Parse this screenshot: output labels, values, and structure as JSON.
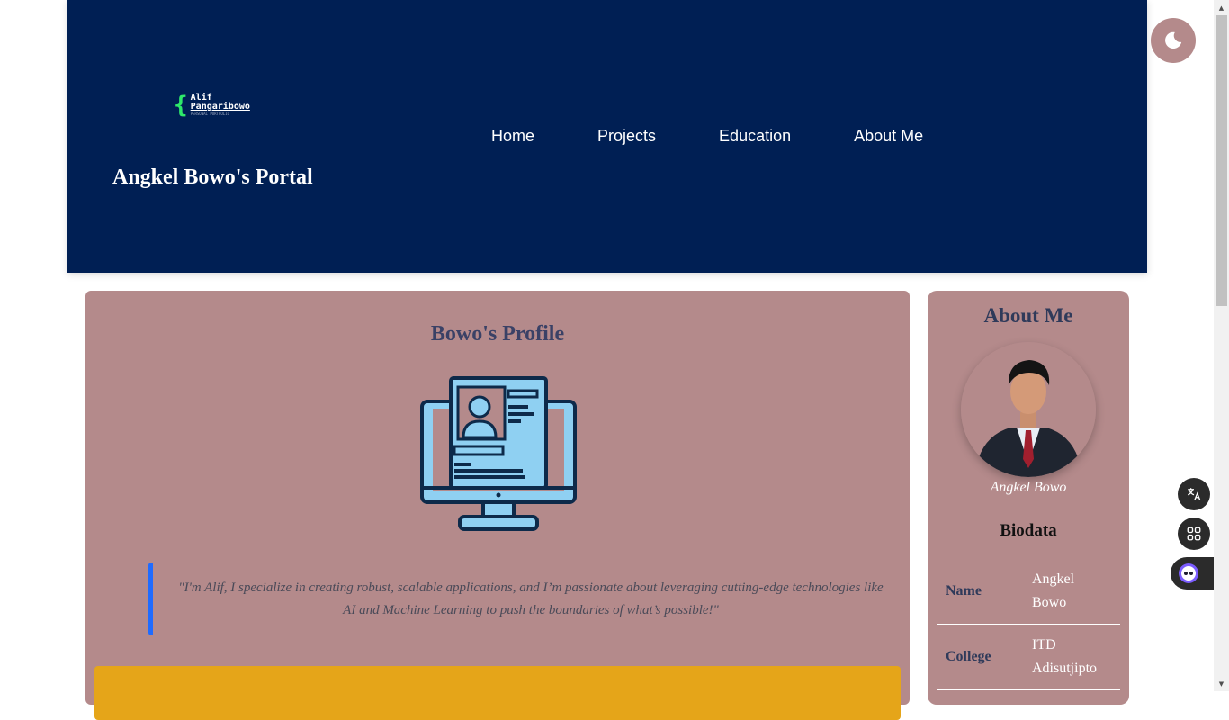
{
  "header": {
    "logo": {
      "line1": "Alif",
      "line2": "Pangaribowo",
      "tagline": "PERSONAL PORTFOLIO"
    },
    "title": "Angkel Bowo's Portal",
    "nav": [
      {
        "label": "Home"
      },
      {
        "label": "Projects"
      },
      {
        "label": "Education"
      },
      {
        "label": "About Me"
      }
    ]
  },
  "theme_toggle": {
    "icon": "moon-icon"
  },
  "profile": {
    "title": "Bowo's Profile",
    "illustration": "computer-profile-icon",
    "quote": "\"I'm Alif, I specialize in creating robust, scalable applications, and I’m passionate about leveraging cutting-edge technologies like AI and Machine Learning to push the boundaries of what’s possible!\""
  },
  "about": {
    "title": "About Me",
    "name": "Angkel Bowo",
    "biodata_title": "Biodata",
    "rows": [
      {
        "key": "Name",
        "value": "Angkel Bowo"
      },
      {
        "key": "College",
        "value": "ITD Adisutjipto"
      }
    ]
  },
  "floating": {
    "translate": "translate-icon",
    "apps": "apps-grid-icon",
    "assistant": "assistant-bot-icon"
  },
  "colors": {
    "header_bg": "#001f54",
    "card_bg": "#b48a8b",
    "accent_blue": "#1f6bff",
    "yellow": "#e5a519"
  }
}
